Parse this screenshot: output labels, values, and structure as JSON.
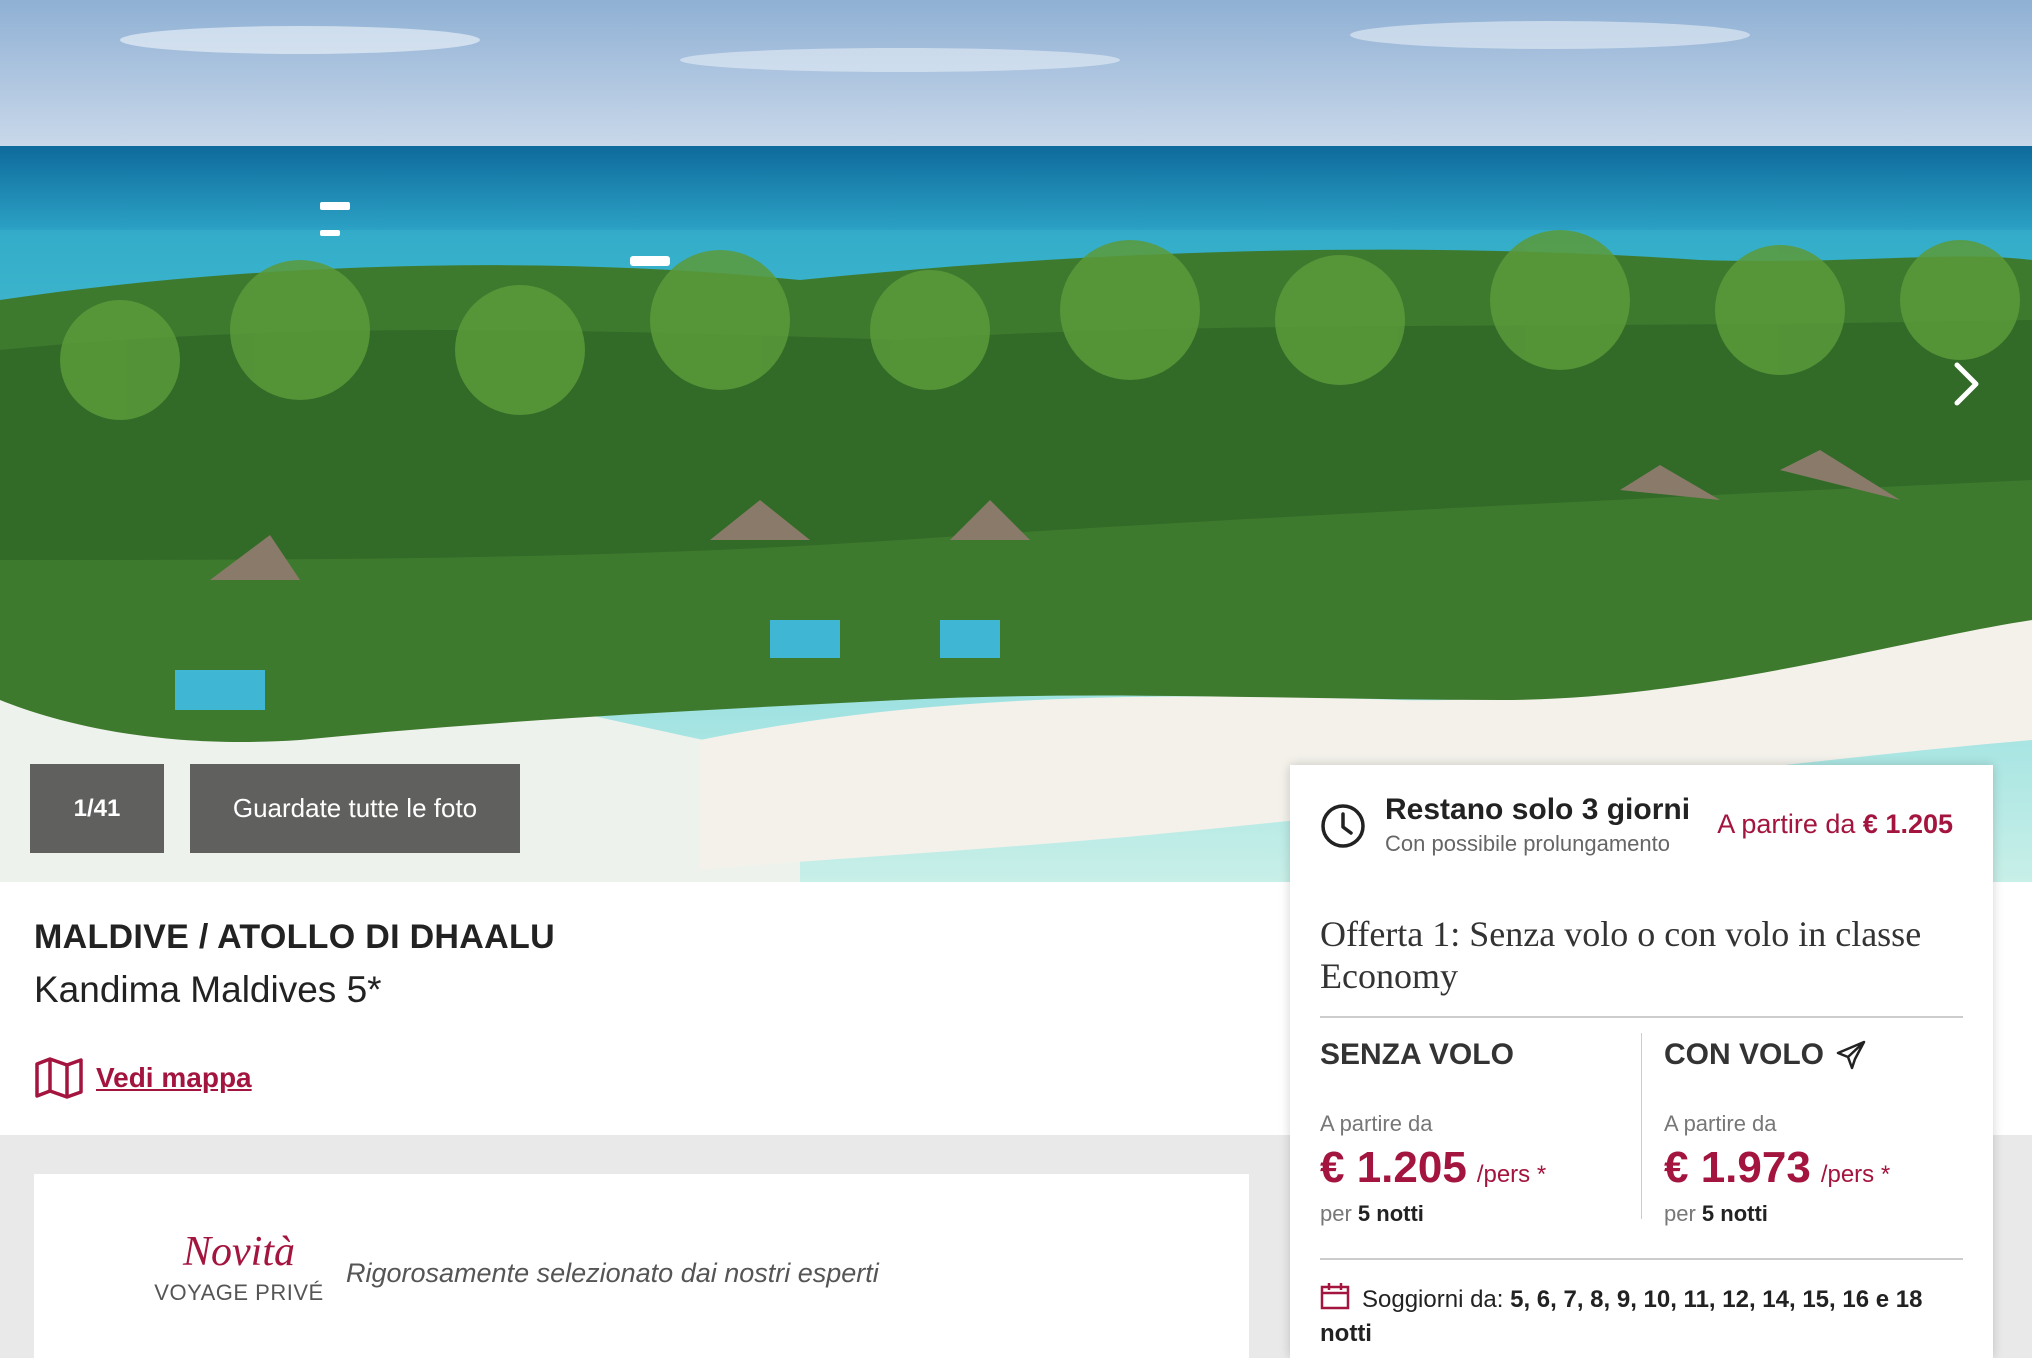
{
  "gallery": {
    "counter": "1/41",
    "all_photos_label": "Guardate tutte le foto"
  },
  "listing": {
    "destination": "MALDIVE / ATOLLO DI DHAALU",
    "hotel_name": "Kandima Maldives 5*",
    "map_link_label": "Vedi mappa"
  },
  "novita": {
    "title": "Novità",
    "subtitle": "VOYAGE PRIVÉ",
    "description": "Rigorosamente selezionato dai nostri esperti"
  },
  "offer": {
    "remaining": "Restano solo 3 giorni",
    "extension": "Con possibile prolungamento",
    "from_prefix": "A partire da",
    "from_price": "€ 1.205",
    "title": "Offerta 1: Senza volo o con volo in classe Economy",
    "without_flight": {
      "title": "SENZA VOLO",
      "from_label": "A partire da",
      "price": "€ 1.205",
      "per": "/pers *",
      "nights_prefix": "per",
      "nights": "5 notti"
    },
    "with_flight": {
      "title": "CON VOLO",
      "from_label": "A partire da",
      "price": "€ 1.973",
      "per": "/pers *",
      "nights_prefix": "per",
      "nights": "5 notti"
    },
    "stays_label": "Soggiorni da:",
    "stays_values": "5, 6, 7, 8, 9, 10, 11, 12, 14, 15, 16 e 18 notti"
  },
  "icons": {
    "next": "chevron-right-icon",
    "map": "map-icon",
    "clock": "clock-icon",
    "plane": "plane-icon",
    "calendar": "calendar-icon"
  },
  "colors": {
    "brand": "#a3143e",
    "band": "#e9e9e9"
  }
}
